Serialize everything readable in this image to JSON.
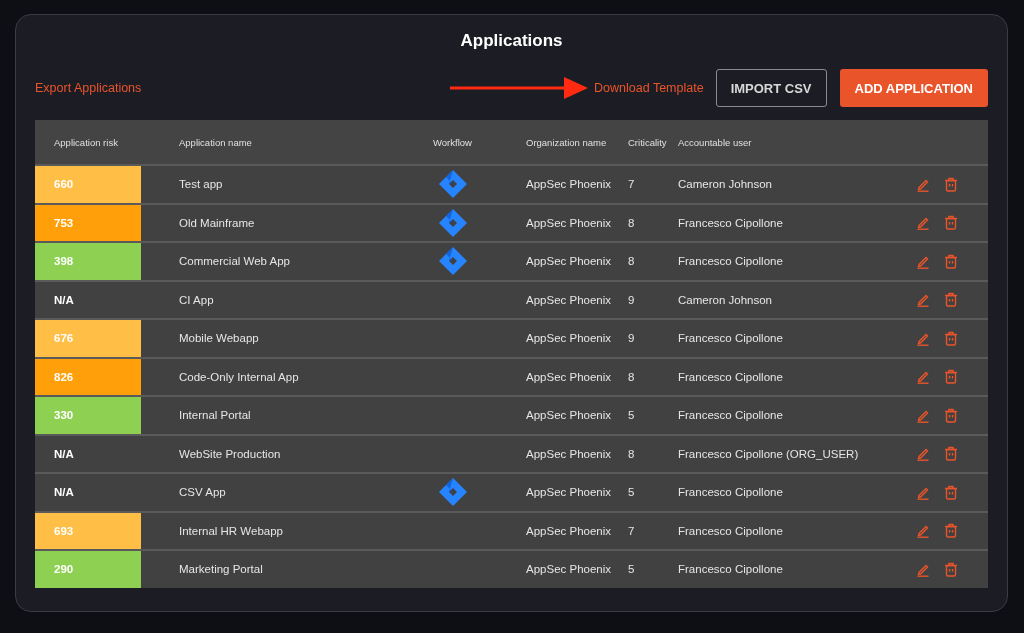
{
  "title": "Applications",
  "toolbar": {
    "export_link": "Export Applications",
    "download_link": "Download Template",
    "import_button": "IMPORT CSV",
    "add_button": "ADD APPLICATION"
  },
  "table": {
    "columns": [
      "Application risk",
      "Application name",
      "Workflow",
      "Organization name",
      "Criticality",
      "Accountable user"
    ],
    "rows": [
      {
        "risk": "660",
        "color": "#ffbf47",
        "name": "Test app",
        "workflow": true,
        "organization": "AppSec Phoenix",
        "criticality": "7",
        "user": "Cameron Johnson"
      },
      {
        "risk": "753",
        "color": "#ff9f0a",
        "name": "Old Mainframe",
        "workflow": true,
        "organization": "AppSec Phoenix",
        "criticality": "8",
        "user": "Francesco Cipollone"
      },
      {
        "risk": "398",
        "color": "#8ed152",
        "name": "Commercial Web App",
        "workflow": true,
        "organization": "AppSec Phoenix",
        "criticality": "8",
        "user": "Francesco Cipollone"
      },
      {
        "risk": "N/A",
        "name": "CI App",
        "workflow": false,
        "organization": "AppSec Phoenix",
        "criticality": "9",
        "user": "Cameron Johnson"
      },
      {
        "risk": "676",
        "color": "#ffbf47",
        "name": "Mobile Webapp",
        "workflow": false,
        "organization": "AppSec Phoenix",
        "criticality": "9",
        "user": "Francesco Cipollone"
      },
      {
        "risk": "826",
        "color": "#ff9f0a",
        "name": "Code-Only Internal App",
        "workflow": false,
        "organization": "AppSec Phoenix",
        "criticality": "8",
        "user": "Francesco Cipollone"
      },
      {
        "risk": "330",
        "color": "#8ed152",
        "name": "Internal Portal",
        "workflow": false,
        "organization": "AppSec Phoenix",
        "criticality": "5",
        "user": "Francesco Cipollone"
      },
      {
        "risk": "N/A",
        "name": "WebSite Production",
        "workflow": false,
        "organization": "AppSec Phoenix",
        "criticality": "8",
        "user": "Francesco Cipollone (ORG_USER)"
      },
      {
        "risk": "N/A",
        "name": "CSV App",
        "workflow": true,
        "organization": "AppSec Phoenix",
        "criticality": "5",
        "user": "Francesco Cipollone"
      },
      {
        "risk": "693",
        "color": "#ffbf47",
        "name": "Internal HR Webapp",
        "workflow": false,
        "organization": "AppSec Phoenix",
        "criticality": "7",
        "user": "Francesco Cipollone"
      },
      {
        "risk": "290",
        "color": "#8ed152",
        "name": "Marketing Portal",
        "workflow": false,
        "organization": "AppSec Phoenix",
        "criticality": "5",
        "user": "Francesco Cipollone"
      }
    ]
  }
}
